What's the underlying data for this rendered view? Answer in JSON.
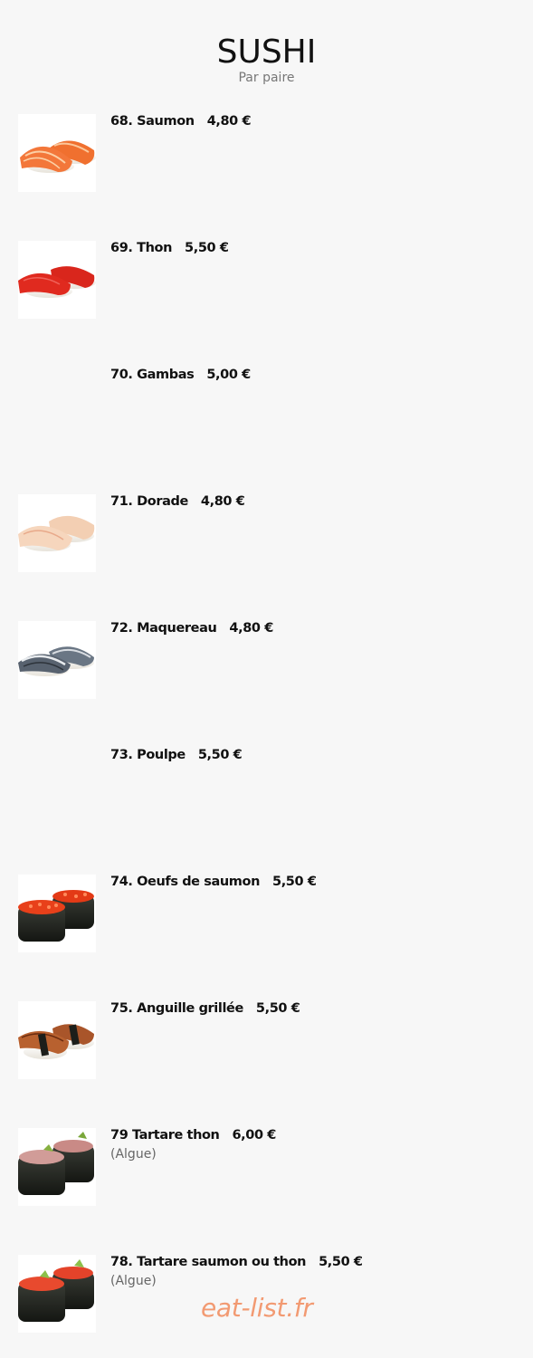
{
  "header": {
    "title": "SUSHI",
    "subtitle": "Par paire"
  },
  "items": [
    {
      "name": "68. Saumon",
      "price": "4,80 €",
      "note": "",
      "image": "salmon-nigiri"
    },
    {
      "name": "69. Thon",
      "price": "5,50 €",
      "note": "",
      "image": "tuna-nigiri"
    },
    {
      "name": "70. Gambas",
      "price": "5,00 €",
      "note": "",
      "image": ""
    },
    {
      "name": "71. Dorade",
      "price": "4,80 €",
      "note": "",
      "image": "sea-bream-nigiri"
    },
    {
      "name": "72. Maquereau",
      "price": "4,80 €",
      "note": "",
      "image": "mackerel-nigiri"
    },
    {
      "name": "73. Poulpe",
      "price": "5,50 €",
      "note": "",
      "image": ""
    },
    {
      "name": "74. Oeufs de saumon",
      "price": "5,50 €",
      "note": "",
      "image": "salmon-roe-gunkan"
    },
    {
      "name": "75. Anguille grillée",
      "price": "5,50 €",
      "note": "",
      "image": "grilled-eel-nigiri"
    },
    {
      "name": "79 Tartare thon",
      "price": "6,00 €",
      "note": "(Algue)",
      "image": "tuna-tartare-gunkan"
    },
    {
      "name": "78. Tartare saumon ou thon",
      "price": "5,50 €",
      "note": "(Algue)",
      "image": "salmon-tartare-gunkan"
    }
  ],
  "watermark": "eat-list.fr"
}
